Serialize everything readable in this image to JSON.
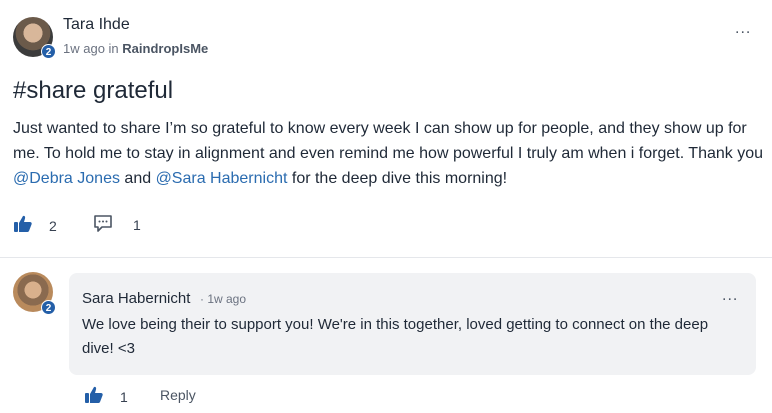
{
  "post": {
    "author": "Tara Ihde",
    "avatar_badge": "2",
    "time": "1w ago",
    "in_label": "in",
    "group": "RaindropIsMe",
    "more_label": "...",
    "title": "#share grateful",
    "body_part1": "Just wanted to share I’m so grateful to know every week I can show up for people, and they show up for me. To hold me to stay in alignment and even remind me how powerful I truly am when i forget. Thank you ",
    "mention1": "@Debra Jones",
    "and_text": " and ",
    "mention2": "@Sara Habernicht",
    "body_part2": " for the deep dive this morning!",
    "like_count": "2",
    "comment_count": "1"
  },
  "comment": {
    "author": "Sara Habernicht",
    "avatar_badge": "2",
    "time": "· 1w ago",
    "more_label": "...",
    "text": "We love being their to support you! We're in this together, loved getting to connect on the deep dive! <3",
    "like_count": "1",
    "reply_label": "Reply"
  },
  "colors": {
    "accent": "#245fa8",
    "mention": "#2b6cb0",
    "comment_bg": "#f1f2f4"
  },
  "icons": [
    "thumbs-up-icon",
    "comment-icon",
    "more-icon"
  ]
}
